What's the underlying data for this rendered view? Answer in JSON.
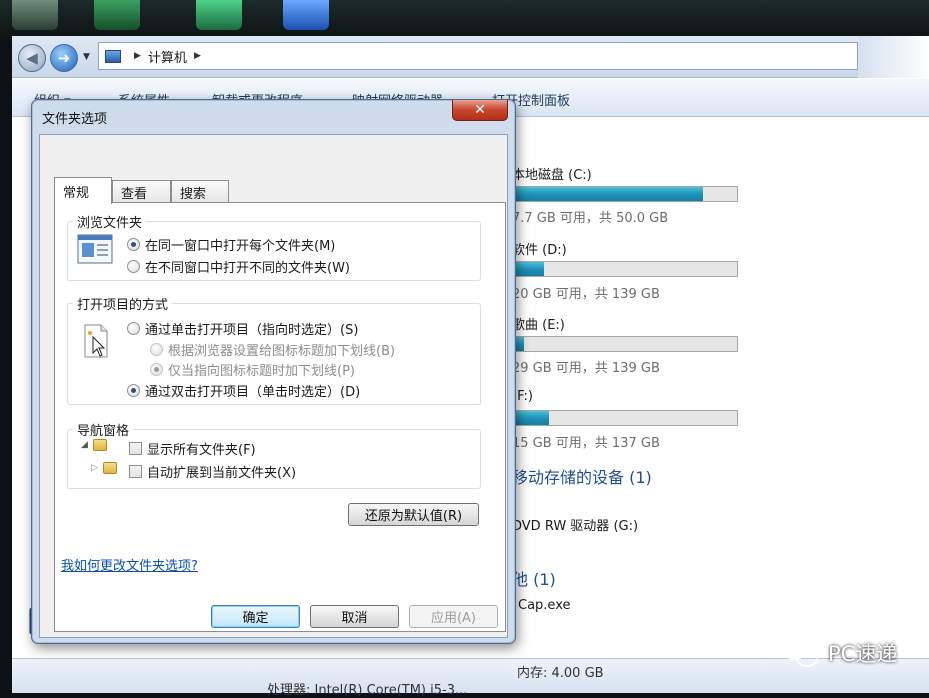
{
  "address": {
    "crumbs": [
      "计算机"
    ]
  },
  "toolbar": {
    "items": [
      "组织 ▾",
      "系统属性",
      "卸载或更改程序",
      "映射网络驱动器",
      "打开控制面板"
    ]
  },
  "drives": [
    {
      "name": "本地磁盘 (C:)",
      "info": "7.7 GB 可用，共 50.0 GB",
      "used": 0.85
    },
    {
      "name": "软件 (D:)",
      "info": "20 GB 可用，共 139 GB",
      "used": 0.14
    },
    {
      "name": "歌曲 (E:)",
      "info": "29 GB 可用，共 139 GB",
      "used": 0.05
    },
    {
      "name": "(F:)",
      "info": "15 GB 可用，共 137 GB",
      "used": 0.16
    }
  ],
  "removable": {
    "header": "可移动存储的设备 (1)",
    "item": "DVD RW 驱动器 (G:)"
  },
  "other": {
    "header": "其他 (1)",
    "item": "Cap.exe"
  },
  "details": {
    "memory": "内存: 4.00 GB",
    "cpu": "处理器: Intel(R) Core(TM) i5-3..."
  },
  "watermark": {
    "text": "PC速递"
  },
  "dialog": {
    "title": "文件夹选项",
    "close_glyph": "✕",
    "tabs": [
      "常规",
      "查看",
      "搜索"
    ],
    "browse": {
      "title": "浏览文件夹",
      "opt_same": "在同一窗口中打开每个文件夹(M)",
      "opt_new": "在不同窗口中打开不同的文件夹(W)"
    },
    "click": {
      "title": "打开项目的方式",
      "opt_single": "通过单击打开项目（指向时选定）(S)",
      "opt_sub_browser": "根据浏览器设置给图标标题加下划线(B)",
      "opt_sub_point": "仅当指向图标标题时加下划线(P)",
      "opt_double": "通过双击打开项目（单击时选定）(D)"
    },
    "nav": {
      "title": "导航窗格",
      "opt_show_all": "显示所有文件夹(F)",
      "opt_expand": "自动扩展到当前文件夹(X)"
    },
    "restore_label": "还原为默认值(R)",
    "help_link": "我如何更改文件夹选项?",
    "ok_label": "确定",
    "cancel_label": "取消",
    "apply_label": "应用(A)"
  }
}
